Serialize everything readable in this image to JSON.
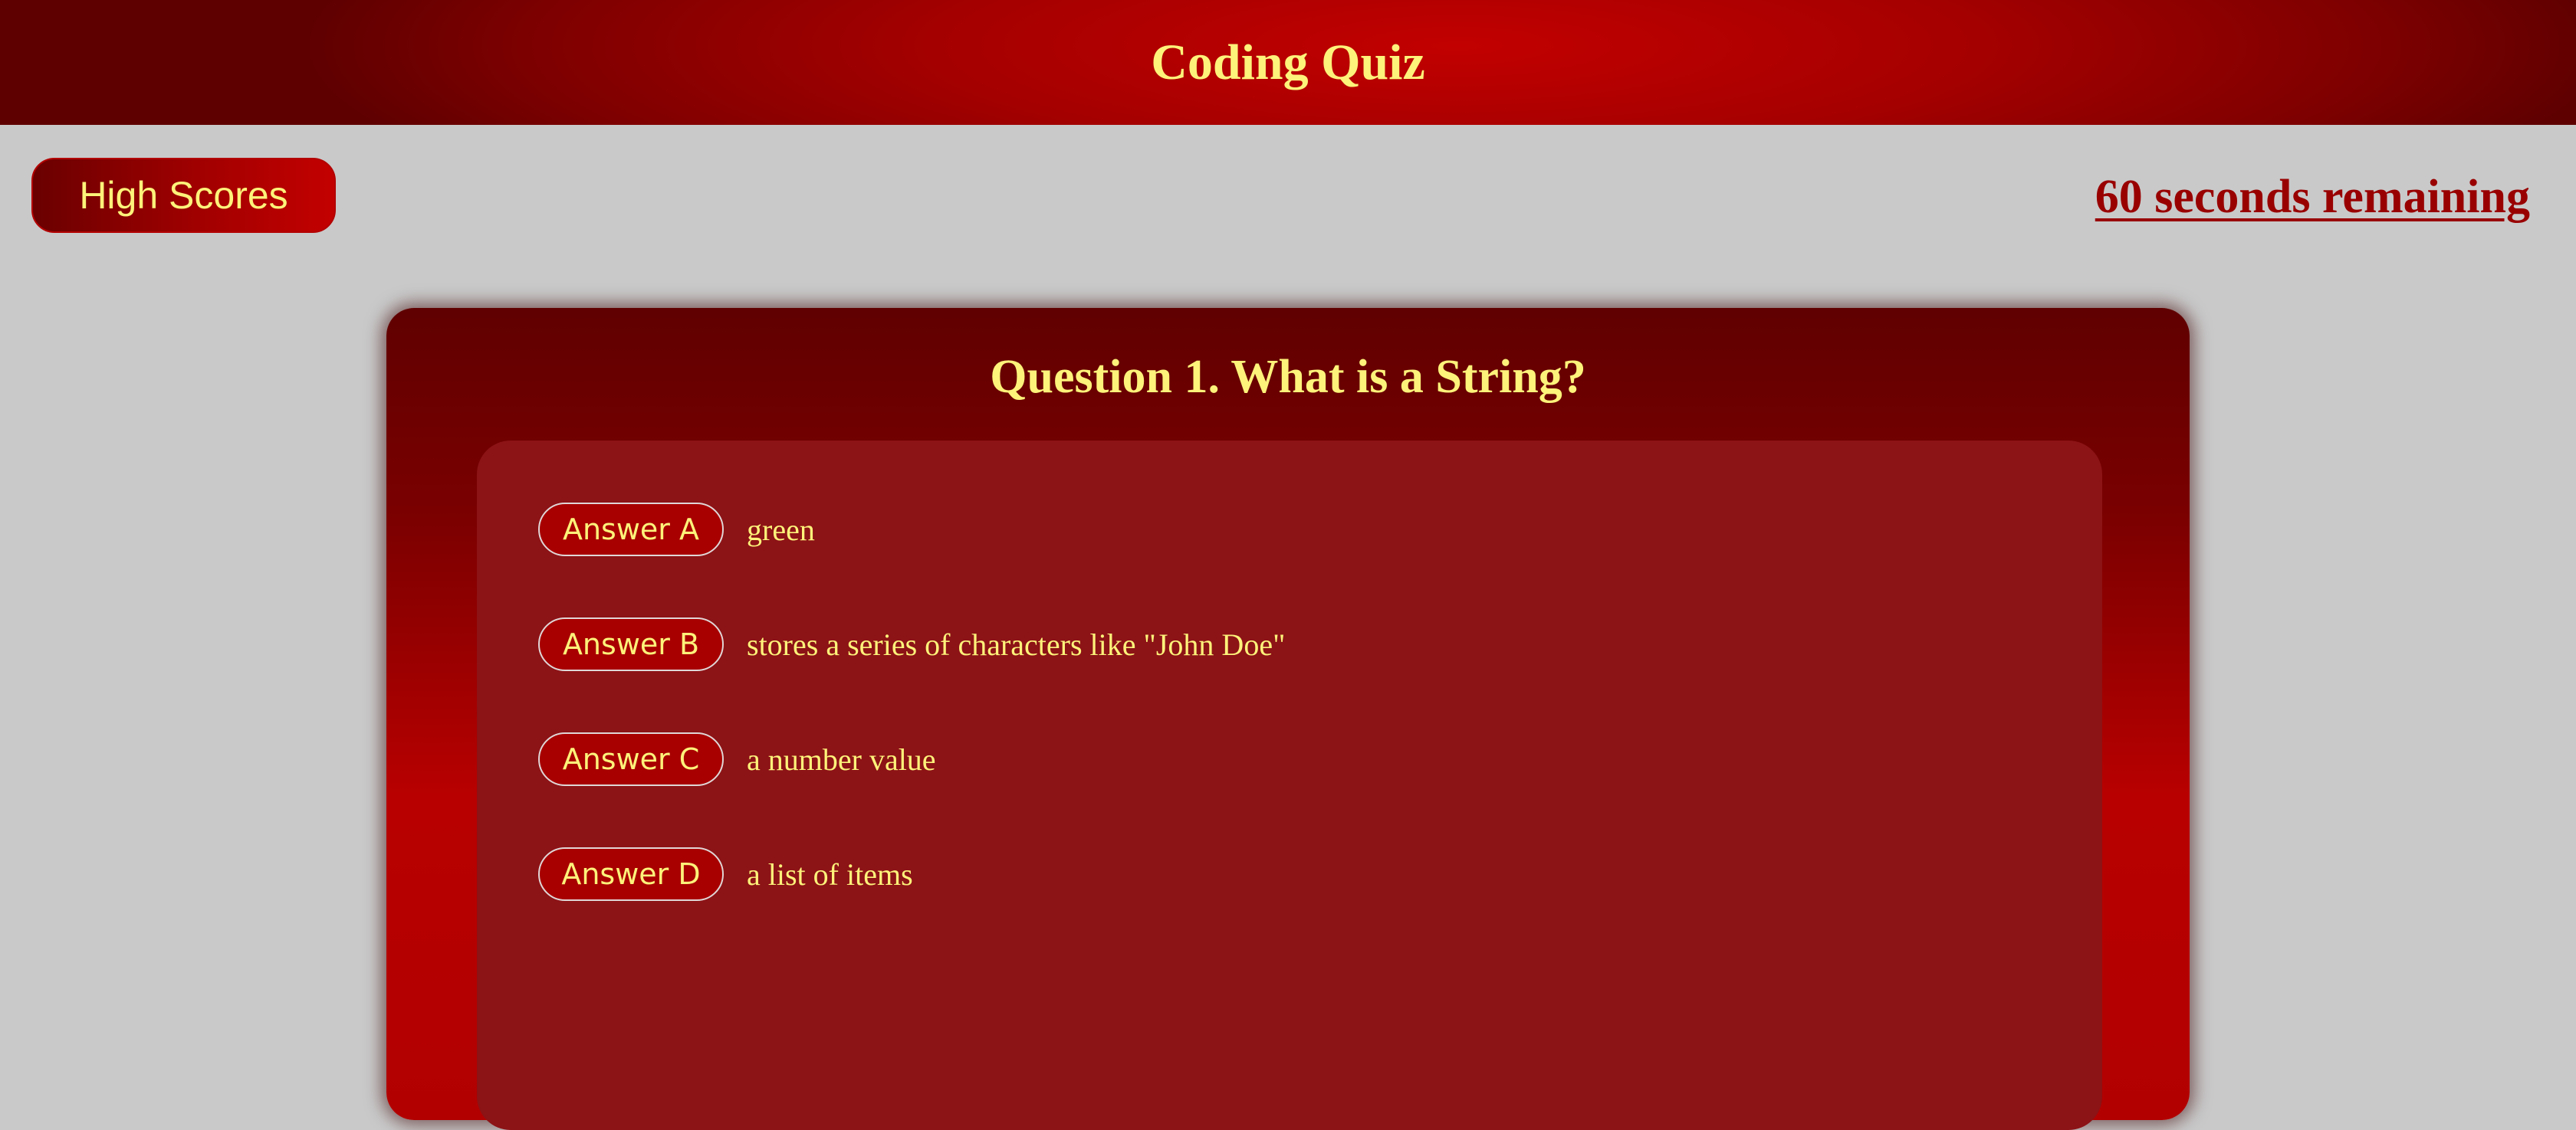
{
  "header": {
    "title": "Coding Quiz"
  },
  "toolbar": {
    "high_scores_label": "High Scores",
    "timer_text": "60 seconds remaining"
  },
  "quiz": {
    "question": "Question 1. What is a String?",
    "answers": [
      {
        "label": "Answer A",
        "text": "green"
      },
      {
        "label": "Answer B",
        "text": "stores a series of characters like \"John Doe\""
      },
      {
        "label": "Answer C",
        "text": "a number value"
      },
      {
        "label": "Answer D",
        "text": "a list of items"
      }
    ]
  },
  "colors": {
    "accent_text": "#fdf27a",
    "primary_red": "#a80000",
    "background": "#c9c9c9"
  }
}
